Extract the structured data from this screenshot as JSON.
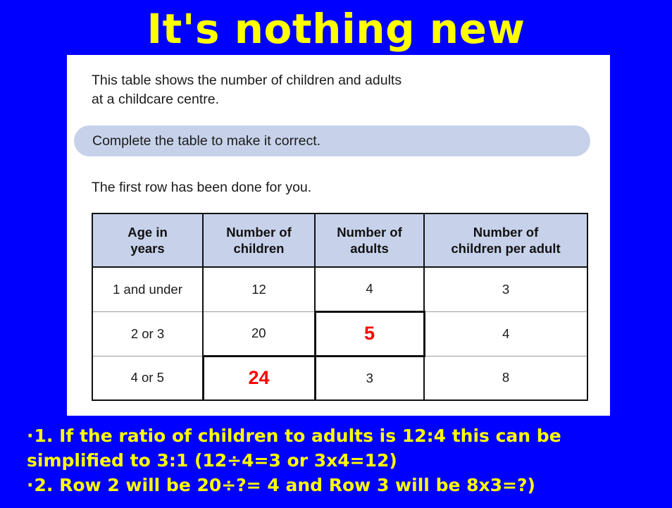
{
  "slide": {
    "title": "It's nothing new",
    "background_color": "#0000FF",
    "title_color": "#FFFF00"
  },
  "worksheet": {
    "intro_line_1": "This table shows the number of children and adults",
    "intro_line_2": "at a childcare centre.",
    "instruction": "Complete the table to make it correct.",
    "instruction_pill_color": "#C7D2EA",
    "first_row_note": "The first row has been done for you."
  },
  "table": {
    "headers": [
      "Age in years",
      "Number of children",
      "Number of adults",
      "Number of children per adult"
    ],
    "header_lines": [
      [
        "Age in",
        "years"
      ],
      [
        "Number of",
        "children"
      ],
      [
        "Number of",
        "adults"
      ],
      [
        "Number of",
        "children per adult"
      ]
    ],
    "header_fill": "#C7D2EA",
    "answer_color": "#FF0000",
    "rows": [
      {
        "age": "1 and under",
        "children": "12",
        "adults": "4",
        "children_per_adult": "3"
      },
      {
        "age": "2 or 3",
        "children": "20",
        "adults": "5",
        "children_per_adult": "4"
      },
      {
        "age": "4 or 5",
        "children": "24",
        "adults": "3",
        "children_per_adult": "8"
      }
    ]
  },
  "notes": {
    "bullet": "·",
    "items": [
      "1. If the ratio of children to adults is 12:4 this can be simplified to 3:1 (12÷4=3 or 3x4=12)",
      "2. Row 2 will be 20÷?= 4 and Row 3 will be 8x3=?)"
    ]
  }
}
